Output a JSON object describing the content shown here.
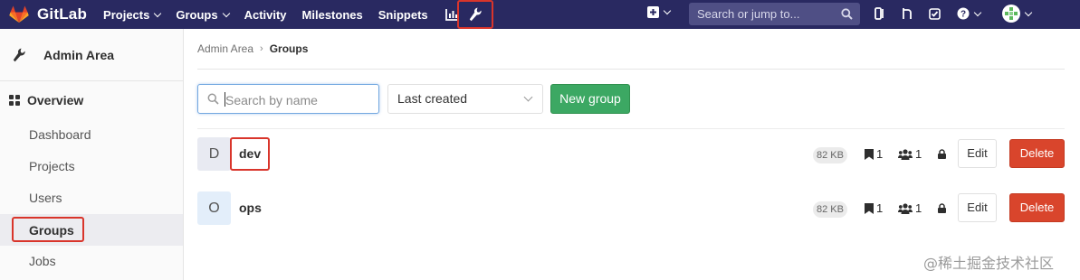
{
  "topnav": {
    "brand": "GitLab",
    "links": [
      {
        "label": "Projects",
        "caret": true
      },
      {
        "label": "Groups",
        "caret": true
      },
      {
        "label": "Activity",
        "caret": false
      },
      {
        "label": "Milestones",
        "caret": false
      },
      {
        "label": "Snippets",
        "caret": false
      }
    ],
    "search_placeholder": "Search or jump to...",
    "colors": {
      "nav_bg": "#292961",
      "highlight": "#d9352b"
    }
  },
  "sidebar": {
    "title": "Admin Area",
    "overview": "Overview",
    "items": [
      {
        "label": "Dashboard"
      },
      {
        "label": "Projects"
      },
      {
        "label": "Users"
      },
      {
        "label": "Groups"
      },
      {
        "label": "Jobs"
      }
    ],
    "active_item": "Groups"
  },
  "breadcrumb": {
    "parent": "Admin Area",
    "current": "Groups"
  },
  "filters": {
    "search_placeholder": "Search by name",
    "sort_value": "Last created",
    "new_group_label": "New group"
  },
  "groups": [
    {
      "initial": "D",
      "name": "dev",
      "size": "82 KB",
      "projects": "1",
      "members": "1",
      "edit": "Edit",
      "delete": "Delete"
    },
    {
      "initial": "O",
      "name": "ops",
      "size": "82 KB",
      "projects": "1",
      "members": "1",
      "edit": "Edit",
      "delete": "Delete"
    }
  ],
  "watermark": "@稀土掘金技术社区",
  "colors": {
    "new_group_green": "#3ca863",
    "delete_red": "#d9452c"
  }
}
